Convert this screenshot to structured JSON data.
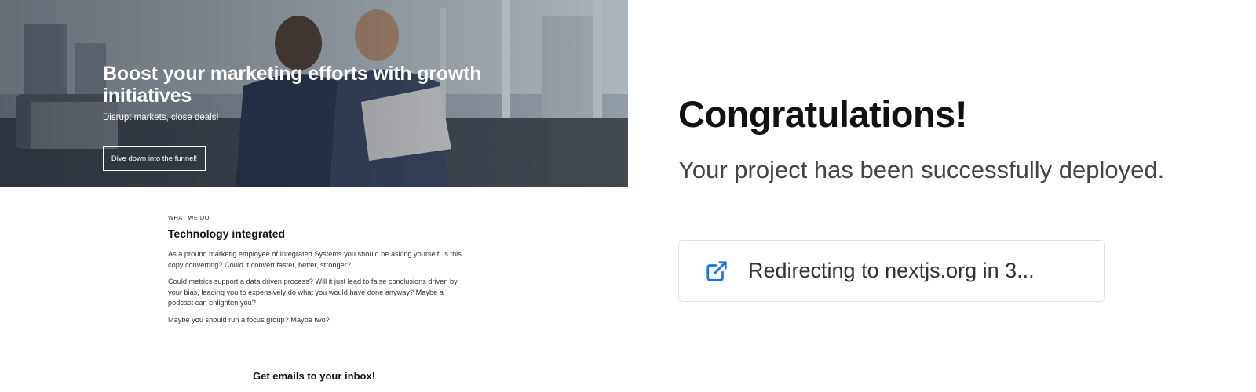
{
  "preview": {
    "hero": {
      "title": "Boost your marketing efforts with growth initiatives",
      "subtitle": "Disrupt markets, close deals!",
      "button_label": "Dive down into the funnel!"
    },
    "section": {
      "eyebrow": "WHAT WE DO",
      "title": "Technology integrated",
      "paragraphs": [
        "As a pround marketig employee of Integrated Systems you should be asking yourself: is this copy converting? Could it convert faster, better, stronger?",
        "Could metrics support a data driven process? Will it just lead to false conclusions driven by your bias, leading you to expensively do what you would have done anyway? Maybe a podcast can enlighten you?",
        "Maybe you should run a focus group? Maybe two?"
      ]
    },
    "newsletter_title": "Get emails to your inbox!"
  },
  "status": {
    "heading": "Congratulations!",
    "message": "Your project has been successfully deployed.",
    "redirect": {
      "icon": "external-link-icon",
      "text": "Redirecting to nextjs.org in 3..."
    }
  },
  "colors": {
    "accent": "#1a73e8",
    "text_primary": "#111111",
    "text_secondary": "#444444",
    "card_border": "#dfe1e5"
  }
}
